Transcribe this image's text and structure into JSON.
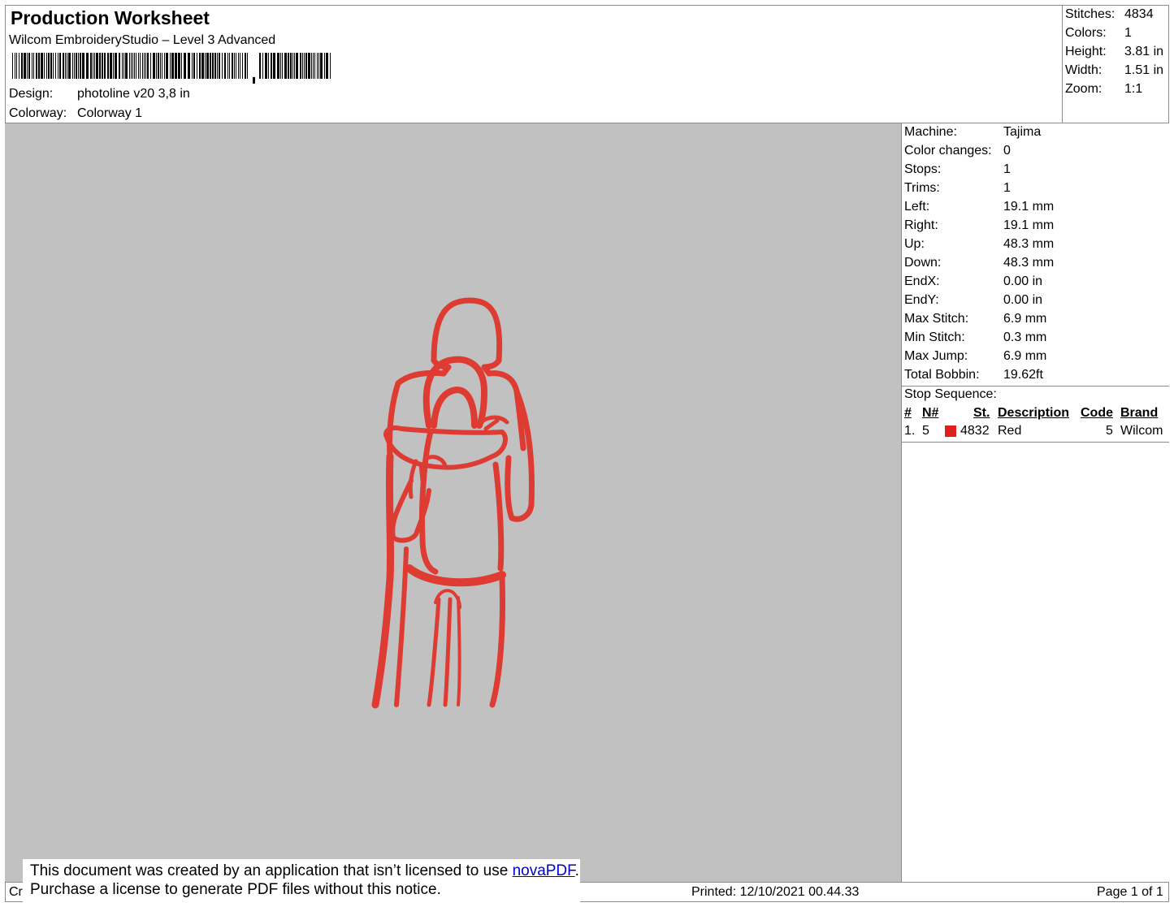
{
  "header": {
    "title": "Production Worksheet",
    "software": "Wilcom EmbroideryStudio – Level 3 Advanced",
    "design_label": "Design:",
    "design_value": "photoline v20 3,8 in",
    "colorway_label": "Colorway:",
    "colorway_value": "Colorway 1"
  },
  "summary": {
    "stitches_label": "Stitches:",
    "stitches_value": "4834",
    "colors_label": "Colors:",
    "colors_value": "1",
    "height_label": "Height:",
    "height_value": "3.81 in",
    "width_label": "Width:",
    "width_value": "1.51 in",
    "zoom_label": "Zoom:",
    "zoom_value": "1:1"
  },
  "details": [
    {
      "label": "Machine:",
      "value": "Tajima"
    },
    {
      "label": "Color changes:",
      "value": "0"
    },
    {
      "label": "Stops:",
      "value": "1"
    },
    {
      "label": "Trims:",
      "value": "1"
    },
    {
      "label": "Left:",
      "value": "19.1 mm"
    },
    {
      "label": "Right:",
      "value": "19.1 mm"
    },
    {
      "label": "Up:",
      "value": "48.3 mm"
    },
    {
      "label": "Down:",
      "value": "48.3 mm"
    },
    {
      "label": "EndX:",
      "value": "0.00 in"
    },
    {
      "label": "EndY:",
      "value": "0.00 in"
    },
    {
      "label": "Max Stitch:",
      "value": "6.9 mm"
    },
    {
      "label": "Min Stitch:",
      "value": "0.3 mm"
    },
    {
      "label": "Max Jump:",
      "value": "6.9 mm"
    },
    {
      "label": "Total Bobbin:",
      "value": "19.62ft"
    }
  ],
  "stop_sequence": {
    "heading": "Stop Sequence:",
    "columns": [
      "#",
      "N#",
      "St.",
      "Description",
      "Code",
      "Brand"
    ],
    "rows": [
      {
        "index": "1.",
        "needle": "5",
        "color": "#e0201e",
        "stitches": "4832",
        "description": "Red",
        "code": "5",
        "brand": "Wilcom"
      }
    ]
  },
  "design_preview": {
    "thread_color": "#de3b33",
    "background": "#c1c1c1"
  },
  "footer": {
    "left_fragment": "Cr",
    "printed": "Printed: 12/10/2021 00.44.33",
    "page": "Page 1 of 1"
  },
  "notice": {
    "line1_prefix": "This document was created by an application that isn’t licensed to use ",
    "link": "novaPDF",
    "line1_suffix": ".",
    "line2": "Purchase a license to generate PDF files without this notice."
  }
}
